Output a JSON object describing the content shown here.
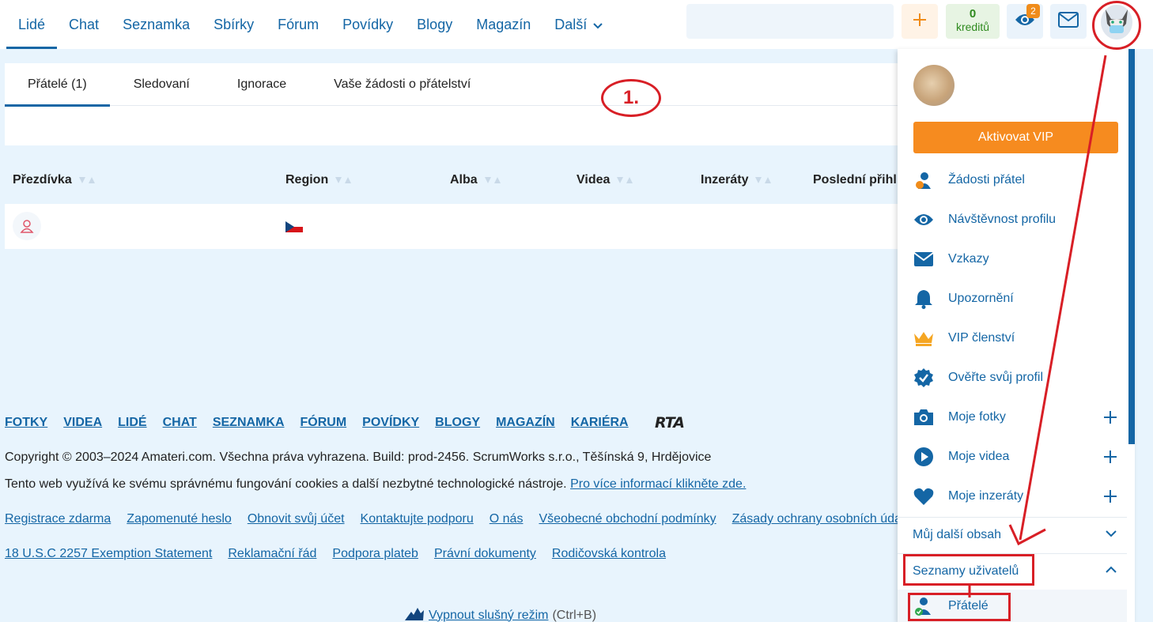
{
  "nav": {
    "items": [
      "Lidé",
      "Chat",
      "Seznamka",
      "Sbírky",
      "Fórum",
      "Povídky",
      "Blogy",
      "Magazín",
      "Další"
    ],
    "active": "Lidé"
  },
  "header": {
    "credits_value": "0",
    "credits_label": "kreditů",
    "eye_badge": "2"
  },
  "tabs": {
    "items": [
      "Přátelé (1)",
      "Sledovaní",
      "Ignorace",
      "Vaše žádosti o přátelství"
    ],
    "active": "Přátelé (1)"
  },
  "table": {
    "headers": [
      "Přezdívka",
      "Region",
      "Alba",
      "Videa",
      "Inzeráty",
      "Poslední přihl"
    ]
  },
  "footer": {
    "main_links": [
      "FOTKY",
      "VIDEA",
      "LIDÉ",
      "CHAT",
      "SEZNAMKA",
      "FÓRUM",
      "POVÍDKY",
      "BLOGY",
      "MAGAZÍN",
      "KARIÉRA"
    ],
    "rta": "RTA",
    "copyright": "Copyright © 2003–2024 Amateri.com. Všechna práva vyhrazena. Build: prod-2456. ScrumWorks s.r.o., Těšínská 9, Hrdějovice",
    "cookies_text": "Tento web využívá ke svému správnému fungování cookies a další nezbytné technologické nástroje.",
    "cookies_link": "Pro více informací klikněte zde.",
    "links_row1": [
      "Registrace zdarma",
      "Zapomenuté heslo",
      "Obnovit svůj účet",
      "Kontaktujte podporu",
      "O nás",
      "Všeobecné obchodní podmínky",
      "Zásady ochrany osobních úda"
    ],
    "links_row2": [
      "18 U.S.C 2257 Exemption Statement",
      "Reklamační řád",
      "Podpora plateb",
      "Právní dokumenty",
      "Rodičovská kontrola"
    ],
    "safe_mode_link": "Vypnout slušný režim",
    "safe_mode_hint": "(Ctrl+B)"
  },
  "dropdown": {
    "vip_button": "Aktivovat VIP",
    "items": [
      "Žádosti přátel",
      "Návštěvnost profilu",
      "Vzkazy",
      "Upozornění",
      "VIP členství",
      "Ověřte svůj profil",
      "Moje fotky",
      "Moje videa",
      "Moje inzeráty"
    ],
    "section_more": "Můj další obsah",
    "section_lists": "Seznamy uživatelů",
    "sub_friends": "Přátelé"
  },
  "annotation": {
    "step_label": "1."
  },
  "colors": {
    "brand_blue": "#1466a5",
    "vip_orange": "#f68b1f",
    "annotation_red": "#d81f26"
  }
}
